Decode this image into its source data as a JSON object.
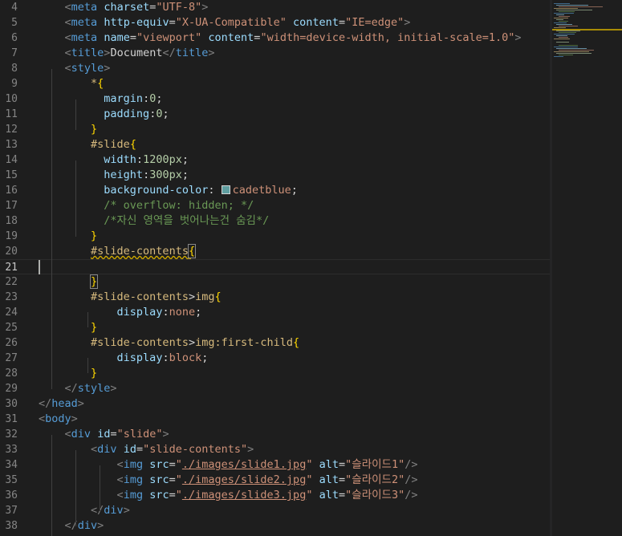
{
  "editor": {
    "lines": [
      {
        "n": "4",
        "html": "    <span class='br'>&lt;</span><span class='tag'>meta</span> <span class='attr'>charset</span><span class='pun'>=</span><span class='str'>\"UTF-8\"</span><span class='br'>&gt;</span>"
      },
      {
        "n": "5",
        "html": "    <span class='br'>&lt;</span><span class='tag'>meta</span> <span class='attr'>http-equiv</span><span class='pun'>=</span><span class='str'>\"X-UA-Compatible\"</span> <span class='attr'>content</span><span class='pun'>=</span><span class='str'>\"IE=edge\"</span><span class='br'>&gt;</span>"
      },
      {
        "n": "6",
        "html": "    <span class='br'>&lt;</span><span class='tag'>meta</span> <span class='attr'>name</span><span class='pun'>=</span><span class='str'>\"viewport\"</span> <span class='attr'>content</span><span class='pun'>=</span><span class='str'>\"width=device-width, initial-scale=1.0\"</span><span class='br'>&gt;</span>"
      },
      {
        "n": "7",
        "html": "    <span class='br'>&lt;</span><span class='tag'>title</span><span class='br'>&gt;</span><span class='txtw'>Document</span><span class='br'>&lt;/</span><span class='tag'>title</span><span class='br'>&gt;</span>"
      },
      {
        "n": "8",
        "html": "    <span class='br'>&lt;</span><span class='tag'>style</span><span class='br'>&gt;</span>"
      },
      {
        "n": "9",
        "html": "        <span class='sel'>*</span><span class='brace'>{</span>"
      },
      {
        "n": "10",
        "html": "          <span class='prop'>margin</span><span class='pun'>:</span><span class='num'>0</span><span class='pun'>;</span>"
      },
      {
        "n": "11",
        "html": "          <span class='prop'>padding</span><span class='pun'>:</span><span class='num'>0</span><span class='pun'>;</span>"
      },
      {
        "n": "12",
        "html": "        <span class='brace'>}</span>"
      },
      {
        "n": "13",
        "html": "        <span class='sel'>#slide</span><span class='brace'>{</span>"
      },
      {
        "n": "14",
        "html": "          <span class='prop'>width</span><span class='pun'>:</span><span class='num'>1200px</span><span class='pun'>;</span>"
      },
      {
        "n": "15",
        "html": "          <span class='prop'>height</span><span class='pun'>:</span><span class='num'>300px</span><span class='pun'>;</span>"
      },
      {
        "n": "16",
        "html": "          <span class='prop'>background-color</span><span class='pun'>: </span><span class='swatch'></span><span class='val'>cadetblue</span><span class='pun'>;</span>"
      },
      {
        "n": "17",
        "html": "          <span class='com'>/* overflow: hidden; */</span>"
      },
      {
        "n": "18",
        "html": "          <span class='com'>/*자신 영역을 벗어나는건 숨김*/</span>"
      },
      {
        "n": "19",
        "html": "        <span class='brace'>}</span>"
      },
      {
        "n": "20",
        "html": "        <span class='sel squiggle'>#slide-contents</span><span class='brace brace-match squiggle'>{</span>"
      },
      {
        "n": "21",
        "html": ""
      },
      {
        "n": "22",
        "html": "        <span class='brace brace-match'>}</span>"
      },
      {
        "n": "23",
        "html": "        <span class='sel'>#slide-contents</span><span class='pun'>&gt;</span><span class='sel'>img</span><span class='brace'>{</span>"
      },
      {
        "n": "24",
        "html": "            <span class='prop'>display</span><span class='pun'>:</span><span class='val'>none</span><span class='pun'>;</span>"
      },
      {
        "n": "25",
        "html": "        <span class='brace'>}</span>"
      },
      {
        "n": "26",
        "html": "        <span class='sel'>#slide-contents</span><span class='pun'>&gt;</span><span class='sel'>img:first-child</span><span class='brace'>{</span>"
      },
      {
        "n": "27",
        "html": "            <span class='prop'>display</span><span class='pun'>:</span><span class='val'>block</span><span class='pun'>;</span>"
      },
      {
        "n": "28",
        "html": "        <span class='brace'>}</span>"
      },
      {
        "n": "29",
        "html": "    <span class='br'>&lt;/</span><span class='tag'>style</span><span class='br'>&gt;</span>"
      },
      {
        "n": "30",
        "html": "<span class='br'>&lt;/</span><span class='tag'>head</span><span class='br'>&gt;</span>"
      },
      {
        "n": "31",
        "html": "<span class='br'>&lt;</span><span class='tag'>body</span><span class='br'>&gt;</span>"
      },
      {
        "n": "32",
        "html": "    <span class='br'>&lt;</span><span class='tag'>div</span> <span class='attr'>id</span><span class='pun'>=</span><span class='str'>\"slide\"</span><span class='br'>&gt;</span>"
      },
      {
        "n": "33",
        "html": "        <span class='br'>&lt;</span><span class='tag'>div</span> <span class='attr'>id</span><span class='pun'>=</span><span class='str'>\"slide-contents\"</span><span class='br'>&gt;</span>"
      },
      {
        "n": "34",
        "html": "            <span class='br'>&lt;</span><span class='tag'>img</span> <span class='attr'>src</span><span class='pun'>=</span><span class='str'>\"</span><span class='strlink'>./images/slide1.jpg</span><span class='str'>\"</span> <span class='attr'>alt</span><span class='pun'>=</span><span class='str'>\"슬라이드1\"</span><span class='br'>/&gt;</span>"
      },
      {
        "n": "35",
        "html": "            <span class='br'>&lt;</span><span class='tag'>img</span> <span class='attr'>src</span><span class='pun'>=</span><span class='str'>\"</span><span class='strlink'>./images/slide2.jpg</span><span class='str'>\"</span> <span class='attr'>alt</span><span class='pun'>=</span><span class='str'>\"슬라이드2\"</span><span class='br'>/&gt;</span>"
      },
      {
        "n": "36",
        "html": "            <span class='br'>&lt;</span><span class='tag'>img</span> <span class='attr'>src</span><span class='pun'>=</span><span class='str'>\"</span><span class='strlink'>./images/slide3.jpg</span><span class='str'>\"</span> <span class='attr'>alt</span><span class='pun'>=</span><span class='str'>\"슬라이드3\"</span><span class='br'>/&gt;</span>"
      },
      {
        "n": "37",
        "html": "        <span class='br'>&lt;/</span><span class='tag'>div</span><span class='br'>&gt;</span>"
      },
      {
        "n": "38",
        "html": "    <span class='br'>&lt;/</span><span class='tag'>div</span><span class='br'>&gt;</span>"
      }
    ],
    "active_line": "21"
  },
  "colors": {
    "background": "#1e1e1e",
    "tag": "#569cd6",
    "attribute": "#9cdcfe",
    "string": "#ce9178",
    "selector": "#d7ba7d",
    "number": "#b5cea8",
    "comment": "#6a9955",
    "brace": "#ffd700",
    "line_number": "#858585"
  }
}
